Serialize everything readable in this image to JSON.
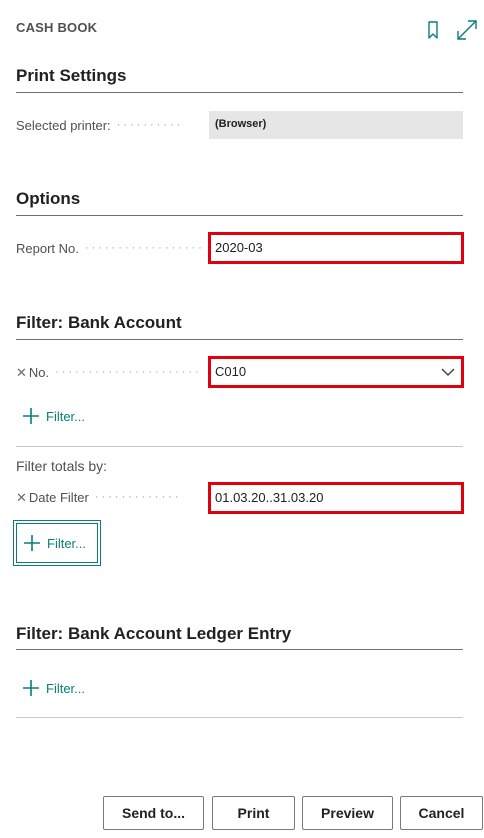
{
  "header": {
    "title": "CASH BOOK",
    "icons": [
      "bookmark-icon",
      "expand-icon"
    ]
  },
  "sections": {
    "print_settings": {
      "title": "Print Settings",
      "selected_printer_label": "Selected printer:",
      "selected_printer_value": "(Browser)"
    },
    "options": {
      "title": "Options",
      "report_no_label": "Report No.",
      "report_no_value": "2020-03"
    },
    "filter_bank_account": {
      "title": "Filter: Bank Account",
      "no_label": "No.",
      "no_value": "C010",
      "add_filter_label": "Filter...",
      "filter_totals_label": "Filter totals by:",
      "date_filter_label": "Date Filter",
      "date_filter_value": "01.03.20..31.03.20",
      "add_filter_totals_label": "Filter..."
    },
    "filter_ledger_entry": {
      "title": "Filter: Bank Account Ledger Entry",
      "add_filter_label": "Filter..."
    }
  },
  "footer": {
    "send_to": "Send to...",
    "print": "Print",
    "preview": "Preview",
    "cancel": "Cancel"
  },
  "colors": {
    "accent": "#0a7d76",
    "highlight_border": "#e2000f",
    "readonly_bg": "#e6e6e6"
  }
}
